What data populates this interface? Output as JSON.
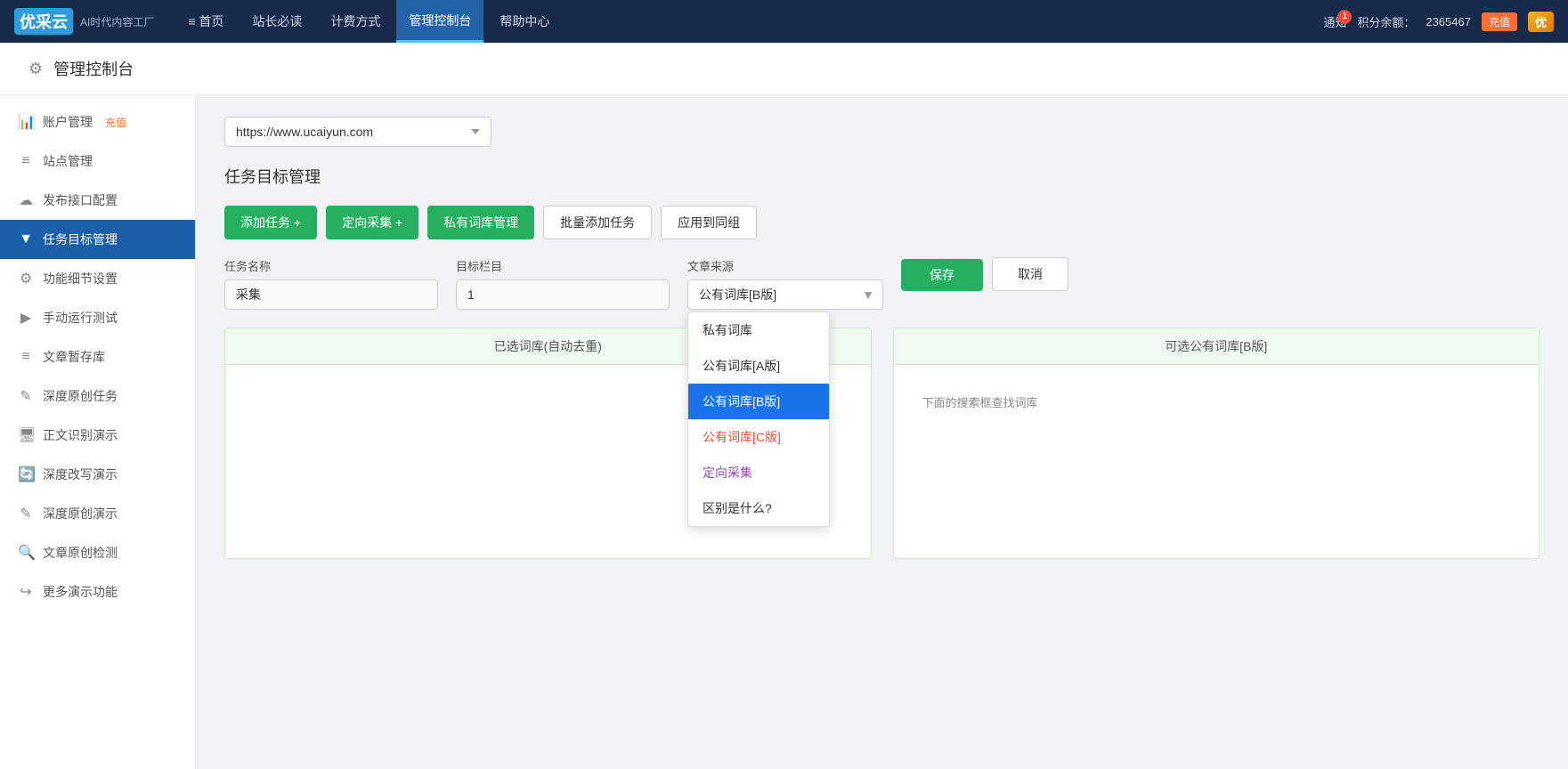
{
  "topnav": {
    "logo_text": "优采云",
    "logo_subtitle": "AI时代内容工厂",
    "menu": [
      {
        "label": "≡ 首页",
        "active": false
      },
      {
        "label": "站长必读",
        "active": false
      },
      {
        "label": "计费方式",
        "active": false
      },
      {
        "label": "管理控制台",
        "active": true
      },
      {
        "label": "帮助中心",
        "active": false
      },
      {
        "label": "通知",
        "active": false
      }
    ],
    "notification_count": "1",
    "points_label": "积分余额：",
    "points_value": "2365467",
    "recharge_label": "充值",
    "vip_label": "优"
  },
  "page_header": {
    "title": "管理控制台"
  },
  "sidebar": {
    "items": [
      {
        "id": "account",
        "icon": "📊",
        "label": "账户管理",
        "badge": "充值",
        "active": false
      },
      {
        "id": "site",
        "icon": "≡",
        "label": "站点管理",
        "active": false
      },
      {
        "id": "publish",
        "icon": "☁",
        "label": "发布接口配置",
        "active": false
      },
      {
        "id": "task",
        "icon": "▼",
        "label": "任务目标管理",
        "active": true
      },
      {
        "id": "settings",
        "icon": "⚙",
        "label": "功能细节设置",
        "active": false
      },
      {
        "id": "manual",
        "icon": "▶",
        "label": "手动运行测试",
        "active": false
      },
      {
        "id": "draft",
        "icon": "≡",
        "label": "文章暂存库",
        "active": false
      },
      {
        "id": "deeporig",
        "icon": "✎",
        "label": "深度原创任务",
        "active": false
      },
      {
        "id": "ocr",
        "icon": "🖥",
        "label": "正文识别演示",
        "active": false
      },
      {
        "id": "rewrite",
        "icon": "🔄",
        "label": "深度改写演示",
        "active": false
      },
      {
        "id": "origdemo",
        "icon": "✎",
        "label": "深度原创演示",
        "active": false
      },
      {
        "id": "check",
        "icon": "🔍",
        "label": "文章原创检测",
        "active": false
      },
      {
        "id": "more",
        "icon": "↪",
        "label": "更多演示功能",
        "active": false
      }
    ]
  },
  "main": {
    "site_url": "https://www.ucaiyun.com",
    "site_placeholder": "https://www.ucaiyun.com",
    "section_title": "任务目标管理",
    "toolbar": {
      "add_task": "添加任务 +",
      "directed_collect": "定向采集 +",
      "private_lib": "私有词库管理",
      "batch_add": "批量添加任务",
      "apply_group": "应用到同组"
    },
    "form": {
      "task_name_label": "任务名称",
      "task_name_value": "采集",
      "category_label": "目标栏目",
      "category_value": "1",
      "source_label": "文章来源",
      "source_value": "公有词库[B版]",
      "save_label": "保存",
      "cancel_label": "取消"
    },
    "source_dropdown": {
      "options": [
        {
          "label": "私有词库",
          "active": false,
          "color": "normal"
        },
        {
          "label": "公有词库[A版]",
          "active": false,
          "color": "normal"
        },
        {
          "label": "公有词库[B版]",
          "active": true,
          "color": "normal"
        },
        {
          "label": "公有词库[C版]",
          "active": false,
          "color": "red"
        },
        {
          "label": "定向采集",
          "active": false,
          "color": "purple"
        },
        {
          "label": "区别是什么?",
          "active": false,
          "color": "normal"
        }
      ]
    },
    "word_bank": {
      "left_header": "已选词库(自动去重)",
      "right_header": "可选公有词库[B版]",
      "right_hint": "下面的搜索框查找词库"
    }
  }
}
